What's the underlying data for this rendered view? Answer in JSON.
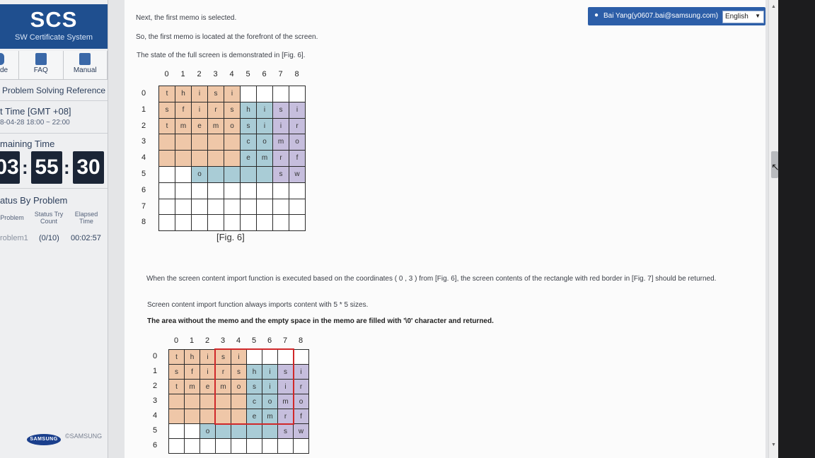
{
  "sidebar": {
    "logo_title": "SCS",
    "logo_subtitle": "SW Certificate System",
    "nav": [
      {
        "label": "de",
        "icon": "code-icon"
      },
      {
        "label": "FAQ",
        "icon": "faq-icon"
      },
      {
        "label": "Manual",
        "icon": "manual-icon"
      }
    ],
    "problem_ref": "Problem Solving Reference",
    "test_time_label": "t Time [GMT +08]",
    "test_time_value": "8-04-28 18:00 ~ 22:00",
    "remaining_label": "maining Time",
    "timer": {
      "h": "03",
      "m": "55",
      "s": "30"
    },
    "status_title": "atus By Problem",
    "status_headers": [
      "Problem",
      "Status Try Count",
      "Elapsed Time"
    ],
    "status_row": {
      "problem": "roblem1",
      "count": "(0/10)",
      "elapsed": "00:02:57"
    },
    "brand_logo_text": "SAMSUNG",
    "copyright": "©SAMSUNG"
  },
  "user": {
    "name": "Bai Yang(y0607.bai@samsung.com)",
    "language": "English"
  },
  "main": {
    "para1": "Next, the first memo is selected.",
    "para2": "So, the first memo is located at the forefront of the screen.",
    "para3": "The state of the full screen is demonstrated in [Fig. 6].",
    "fig6_caption": "[Fig. 6]",
    "para4": "When the screen content import function is executed based on the coordinates ( 0 , 3 ) from [Fig. 6], the screen contents of the rectangle with red border in [Fig. 7] should be returned.",
    "para5": "Screen content import function always imports content with 5 * 5 sizes.",
    "para6": "The area without the memo and the empty space in the memo are filled with '\\0' character and returned."
  },
  "grid": {
    "col_labels": [
      "0",
      "1",
      "2",
      "3",
      "4",
      "5",
      "6",
      "7",
      "8"
    ],
    "row_labels": [
      "0",
      "1",
      "2",
      "3",
      "4",
      "5",
      "6",
      "7",
      "8"
    ],
    "cells": [
      [
        "t",
        "h",
        "i",
        "s",
        "i",
        "",
        "",
        "",
        ""
      ],
      [
        "s",
        "f",
        "i",
        "r",
        "s",
        "h",
        "i",
        "s",
        "i"
      ],
      [
        "t",
        "m",
        "e",
        "m",
        "o",
        "s",
        "i",
        "i",
        "r"
      ],
      [
        "",
        "",
        "",
        "",
        "",
        "c",
        "o",
        "m",
        "o"
      ],
      [
        "",
        "",
        "",
        "",
        "",
        "e",
        "m",
        "r",
        "f"
      ],
      [
        "",
        "",
        "o",
        "",
        "",
        "",
        "",
        "s",
        "w"
      ],
      [
        "",
        "",
        "",
        "",
        "",
        "",
        "",
        "",
        ""
      ],
      [
        "",
        "",
        "",
        "",
        "",
        "",
        "",
        "",
        ""
      ],
      [
        "",
        "",
        "",
        "",
        "",
        "",
        "",
        "",
        ""
      ]
    ],
    "fills": [
      [
        "o",
        "o",
        "o",
        "o",
        "o",
        "w",
        "w",
        "w",
        "w"
      ],
      [
        "o",
        "o",
        "o",
        "o",
        "o",
        "b",
        "b",
        "p",
        "p"
      ],
      [
        "o",
        "o",
        "o",
        "o",
        "o",
        "b",
        "b",
        "p",
        "p"
      ],
      [
        "o",
        "o",
        "o",
        "o",
        "o",
        "b",
        "b",
        "p",
        "p"
      ],
      [
        "o",
        "o",
        "o",
        "o",
        "o",
        "b",
        "b",
        "p",
        "p"
      ],
      [
        "w",
        "w",
        "b",
        "b",
        "b",
        "b",
        "b",
        "p",
        "p"
      ],
      [
        "w",
        "w",
        "w",
        "w",
        "w",
        "w",
        "w",
        "w",
        "w"
      ],
      [
        "w",
        "w",
        "w",
        "w",
        "w",
        "w",
        "w",
        "w",
        "w"
      ],
      [
        "w",
        "w",
        "w",
        "w",
        "w",
        "w",
        "w",
        "w",
        "w"
      ]
    ],
    "colors": {
      "o": "#efc7a8",
      "b": "#a9ccd6",
      "p": "#c6bedd",
      "w": "#ffffff"
    }
  }
}
